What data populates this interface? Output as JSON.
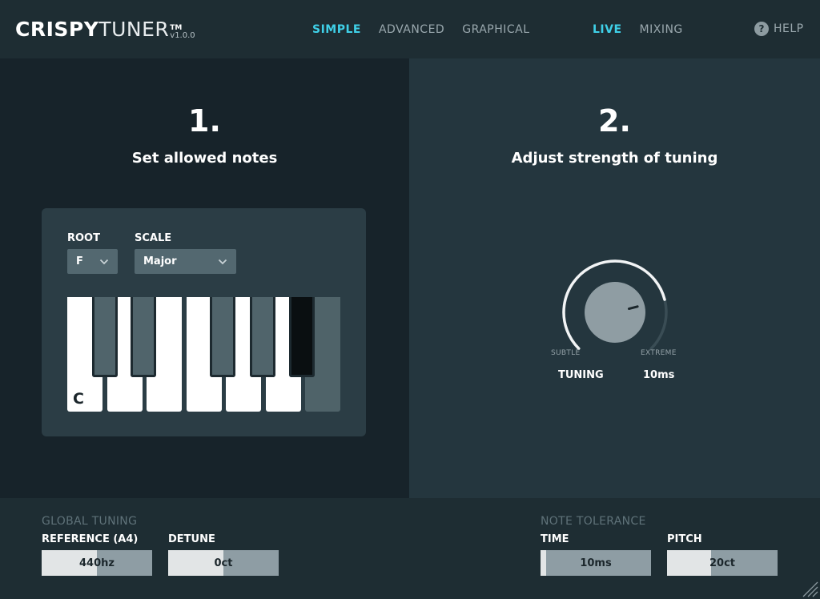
{
  "app": {
    "logo_bold": "CRISPY",
    "logo_light": "TUNER",
    "logo_tm": "TM",
    "version": "v1.0.0"
  },
  "nav": {
    "modes": [
      {
        "label": "SIMPLE",
        "active": true
      },
      {
        "label": "ADVANCED",
        "active": false
      },
      {
        "label": "GRAPHICAL",
        "active": false
      }
    ],
    "views": [
      {
        "label": "LIVE",
        "active": true
      },
      {
        "label": "MIXING",
        "active": false
      }
    ],
    "help_label": "HELP",
    "help_glyph": "?"
  },
  "step1": {
    "number": "1.",
    "title": "Set allowed notes",
    "root_label": "ROOT",
    "root_value": "F",
    "scale_label": "SCALE",
    "scale_value": "Major",
    "keyboard": {
      "white_keys": [
        {
          "note": "C",
          "enabled": true,
          "label": "C"
        },
        {
          "note": "D",
          "enabled": true
        },
        {
          "note": "E",
          "enabled": true
        },
        {
          "note": "F",
          "enabled": true
        },
        {
          "note": "G",
          "enabled": true
        },
        {
          "note": "A",
          "enabled": true
        },
        {
          "note": "B",
          "enabled": false
        }
      ],
      "black_keys": [
        {
          "note": "C#",
          "enabled": false
        },
        {
          "note": "D#",
          "enabled": false
        },
        {
          "note": "F#",
          "enabled": false
        },
        {
          "note": "G#",
          "enabled": false
        },
        {
          "note": "A#",
          "enabled": true
        }
      ]
    }
  },
  "step2": {
    "number": "2.",
    "title": "Adjust strength of tuning",
    "knob": {
      "min_label": "SUBTLE",
      "max_label": "EXTREME",
      "param_label": "TUNING",
      "value_label": "10ms",
      "level": 0.78
    }
  },
  "global_tuning": {
    "title": "GLOBAL TUNING",
    "reference": {
      "label": "REFERENCE (A4)",
      "value": "440hz",
      "level": 0.5
    },
    "detune": {
      "label": "DETUNE",
      "value": "0ct",
      "level": 0.5
    }
  },
  "note_tolerance": {
    "title": "NOTE TOLERANCE",
    "time": {
      "label": "TIME",
      "value": "10ms",
      "level": 0.05
    },
    "pitch": {
      "label": "PITCH",
      "value": "20ct",
      "level": 0.4
    }
  },
  "colors": {
    "accent": "#3fd0e8",
    "key_on": "#ffffff",
    "key_off": "#4f6369",
    "black_key_on": "#0a0f11"
  }
}
